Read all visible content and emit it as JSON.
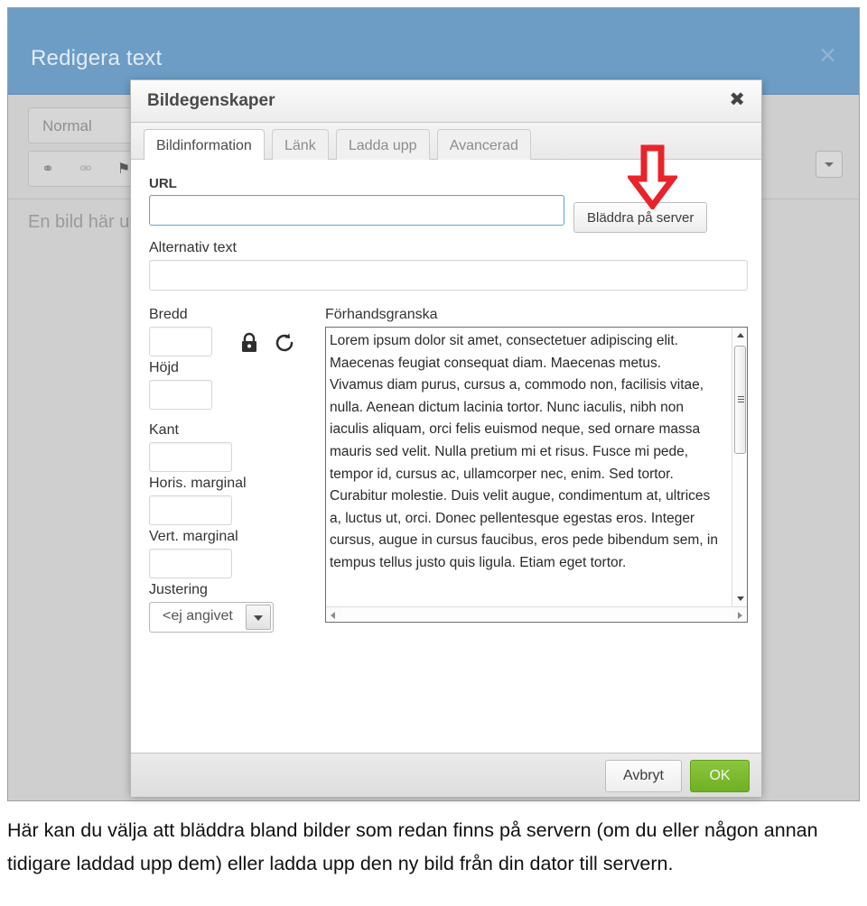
{
  "background_modal": {
    "title": "Redigera text",
    "close_icon": "close-icon",
    "header_color": "#6d9dc5",
    "toolbar": {
      "style_select_value": "Normal",
      "tools": [
        {
          "name": "link-icon",
          "glyph": "⚭"
        },
        {
          "name": "unlink-icon",
          "glyph": "⚮"
        },
        {
          "name": "anchor-flag-icon",
          "glyph": "⚑"
        }
      ],
      "collapse_toolbar_icon": "chevron-down-icon"
    },
    "editor_body_text": "En bild här u"
  },
  "dialog": {
    "title": "Bildegenskaper",
    "close_icon": "close-icon",
    "tabs": [
      {
        "label": "Bildinformation",
        "active": true
      },
      {
        "label": "Länk",
        "active": false
      },
      {
        "label": "Ladda upp",
        "active": false
      },
      {
        "label": "Avancerad",
        "active": false
      }
    ],
    "fields": {
      "url_label": "URL",
      "url_value": "",
      "url_placeholder": "",
      "browse_button": "Bläddra på server",
      "alt_label": "Alternativ text",
      "alt_value": "",
      "alt_placeholder": "",
      "width_label": "Bredd",
      "width_value": "",
      "height_label": "Höjd",
      "height_value": "",
      "border_label": "Kant",
      "border_value": "",
      "hspace_label": "Horis. marginal",
      "hspace_value": "",
      "vspace_label": "Vert. marginal",
      "vspace_value": "",
      "align_label": "Justering",
      "align_value": "<ej angivet",
      "lock_icon": "lock-closed-icon",
      "reset_icon": "reset-refresh-icon",
      "align_dropdown_icon": "chevron-down-icon"
    },
    "preview": {
      "label": "Förhandsgranska",
      "text": "Lorem ipsum dolor sit amet, consectetuer adipiscing elit. Maecenas feugiat consequat diam. Maecenas metus. Vivamus diam purus, cursus a, commodo non, facilisis vitae, nulla. Aenean dictum lacinia tortor. Nunc iaculis, nibh non iaculis aliquam, orci felis euismod neque, sed ornare massa mauris sed velit. Nulla pretium mi et risus. Fusce mi pede, tempor id, cursus ac, ullamcorper nec, enim. Sed tortor. Curabitur molestie. Duis velit augue, condimentum at, ultrices a, luctus ut, orci. Donec pellentesque egestas eros. Integer cursus, augue in cursus faucibus, eros pede bibendum sem, in tempus tellus justo quis ligula. Etiam eget tortor.",
      "vertical_scrollbar_icon": "scrollbar-vertical",
      "horizontal_scrollbar_icon": "scrollbar-horizontal"
    },
    "footer": {
      "cancel_label": "Avbryt",
      "ok_label": "OK",
      "ok_color": "#7cba2f"
    }
  },
  "annotation": {
    "arrow_icon": "red-down-arrow",
    "arrow_color": "#e8232a"
  },
  "caption": {
    "text": "Här kan du välja att bläddra bland bilder som redan finns på servern (om du eller någon annan tidigare laddad upp dem) eller ladda upp den ny bild från din dator till servern."
  }
}
